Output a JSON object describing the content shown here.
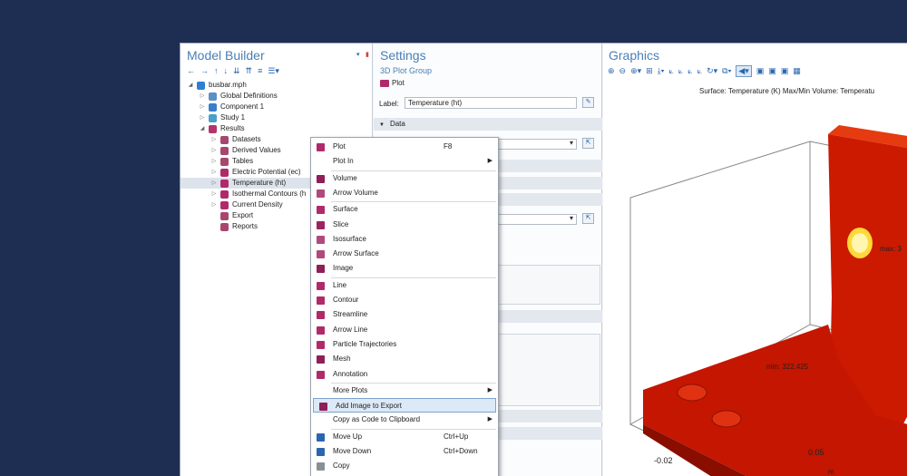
{
  "model_builder": {
    "title": "Model Builder",
    "toolbar_icons": [
      "arrow-left-icon",
      "arrow-right-icon",
      "arrow-up-icon",
      "arrow-down-icon",
      "show-icon",
      "collapse-icon",
      "expand-icon",
      "list-icon"
    ],
    "tree": [
      {
        "label": "busbar.mph",
        "depth": 0,
        "arrow": "◢",
        "icon": "#2e7fd0"
      },
      {
        "label": "Global Definitions",
        "depth": 1,
        "arrow": "▷",
        "icon": "#5a8fc7"
      },
      {
        "label": "Component 1",
        "depth": 1,
        "arrow": "▷",
        "icon": "#3b7ec9"
      },
      {
        "label": "Study 1",
        "depth": 1,
        "arrow": "▷",
        "icon": "#4aa0c8"
      },
      {
        "label": "Results",
        "depth": 1,
        "arrow": "◢",
        "icon": "#b5336d"
      },
      {
        "label": "Datasets",
        "depth": 2,
        "arrow": "▷",
        "icon": "#a8476e"
      },
      {
        "label": "Derived Values",
        "depth": 2,
        "arrow": "▷",
        "icon": "#a8476e"
      },
      {
        "label": "Tables",
        "depth": 2,
        "arrow": "▷",
        "icon": "#a8476e"
      },
      {
        "label": "Electric Potential (ec)",
        "depth": 2,
        "arrow": "▷",
        "icon": "#b02a6a"
      },
      {
        "label": "Temperature (ht)",
        "depth": 2,
        "arrow": "▷",
        "icon": "#b02a6a",
        "selected": true
      },
      {
        "label": "Isothermal Contours (h",
        "depth": 2,
        "arrow": "▷",
        "icon": "#b02a6a"
      },
      {
        "label": "Current Density",
        "depth": 2,
        "arrow": "▷",
        "icon": "#b02a6a"
      },
      {
        "label": "Export",
        "depth": 2,
        "arrow": "",
        "icon": "#a8476e"
      },
      {
        "label": "Reports",
        "depth": 2,
        "arrow": "",
        "icon": "#a8476e"
      }
    ]
  },
  "settings": {
    "title": "Settings",
    "subtitle": "3D Plot Group",
    "plot_button": "Plot",
    "label_caption": "Label:",
    "label_value": "Temperature (ht)",
    "data_section": "Data",
    "partial_text_1": "sions",
    "partial_text_2": "values"
  },
  "graphics": {
    "title": "Graphics",
    "surface_caption": "Surface: Temperature (K)  Max/Min Volume: Temperatu",
    "max_label": "max: 3",
    "min_label": "min: 322.425",
    "tick_005": "0.05",
    "tick_neg002": "-0.02",
    "axis_m": "m"
  },
  "context_menu": {
    "items": [
      {
        "label": "Plot",
        "shortcut": "F8",
        "icon": "plot-icon",
        "color": "#b02a6a"
      },
      {
        "label": "Plot In",
        "submenu": true
      },
      {
        "sep": true
      },
      {
        "label": "Volume",
        "icon": "volume-icon",
        "color": "#8e1f57"
      },
      {
        "label": "Arrow Volume",
        "icon": "arrow-volume-icon",
        "color": "#b04a7c"
      },
      {
        "sep": true
      },
      {
        "label": "Surface",
        "icon": "surface-icon",
        "color": "#b02a6a"
      },
      {
        "label": "Slice",
        "icon": "slice-icon",
        "color": "#9a2460"
      },
      {
        "label": "Isosurface",
        "icon": "isosurface-icon",
        "color": "#b04a7c"
      },
      {
        "label": "Arrow Surface",
        "icon": "arrow-surface-icon",
        "color": "#b04a7c"
      },
      {
        "label": "Image",
        "icon": "image-icon",
        "color": "#8e1f57"
      },
      {
        "sep": true
      },
      {
        "label": "Line",
        "icon": "line-icon",
        "color": "#b02a6a"
      },
      {
        "label": "Contour",
        "icon": "contour-icon",
        "color": "#b02a6a"
      },
      {
        "label": "Streamline",
        "icon": "streamline-icon",
        "color": "#b02a6a"
      },
      {
        "label": "Arrow Line",
        "icon": "arrow-line-icon",
        "color": "#b02a6a"
      },
      {
        "label": "Particle Trajectories",
        "icon": "particle-trajectories-icon",
        "color": "#b02a6a"
      },
      {
        "label": "Mesh",
        "icon": "mesh-icon",
        "color": "#8e1f57"
      },
      {
        "label": "Annotation",
        "icon": "annotation-icon",
        "color": "#b02a6a"
      },
      {
        "sep": true
      },
      {
        "label": "More Plots",
        "submenu": true
      },
      {
        "label": "Add Image to Export",
        "icon": "add-image-to-export-icon",
        "color": "#8e1f57",
        "highlight": true
      },
      {
        "label": "Copy as Code to Clipboard",
        "submenu": true
      },
      {
        "sep": true
      },
      {
        "label": "Move Up",
        "shortcut": "Ctrl+Up",
        "icon": "move-up-icon",
        "color": "#2a66b0"
      },
      {
        "label": "Move Down",
        "shortcut": "Ctrl+Down",
        "icon": "move-down-icon",
        "color": "#2a66b0"
      },
      {
        "label": "Copy",
        "icon": "copy-icon",
        "color": "#8a8f96"
      }
    ]
  }
}
